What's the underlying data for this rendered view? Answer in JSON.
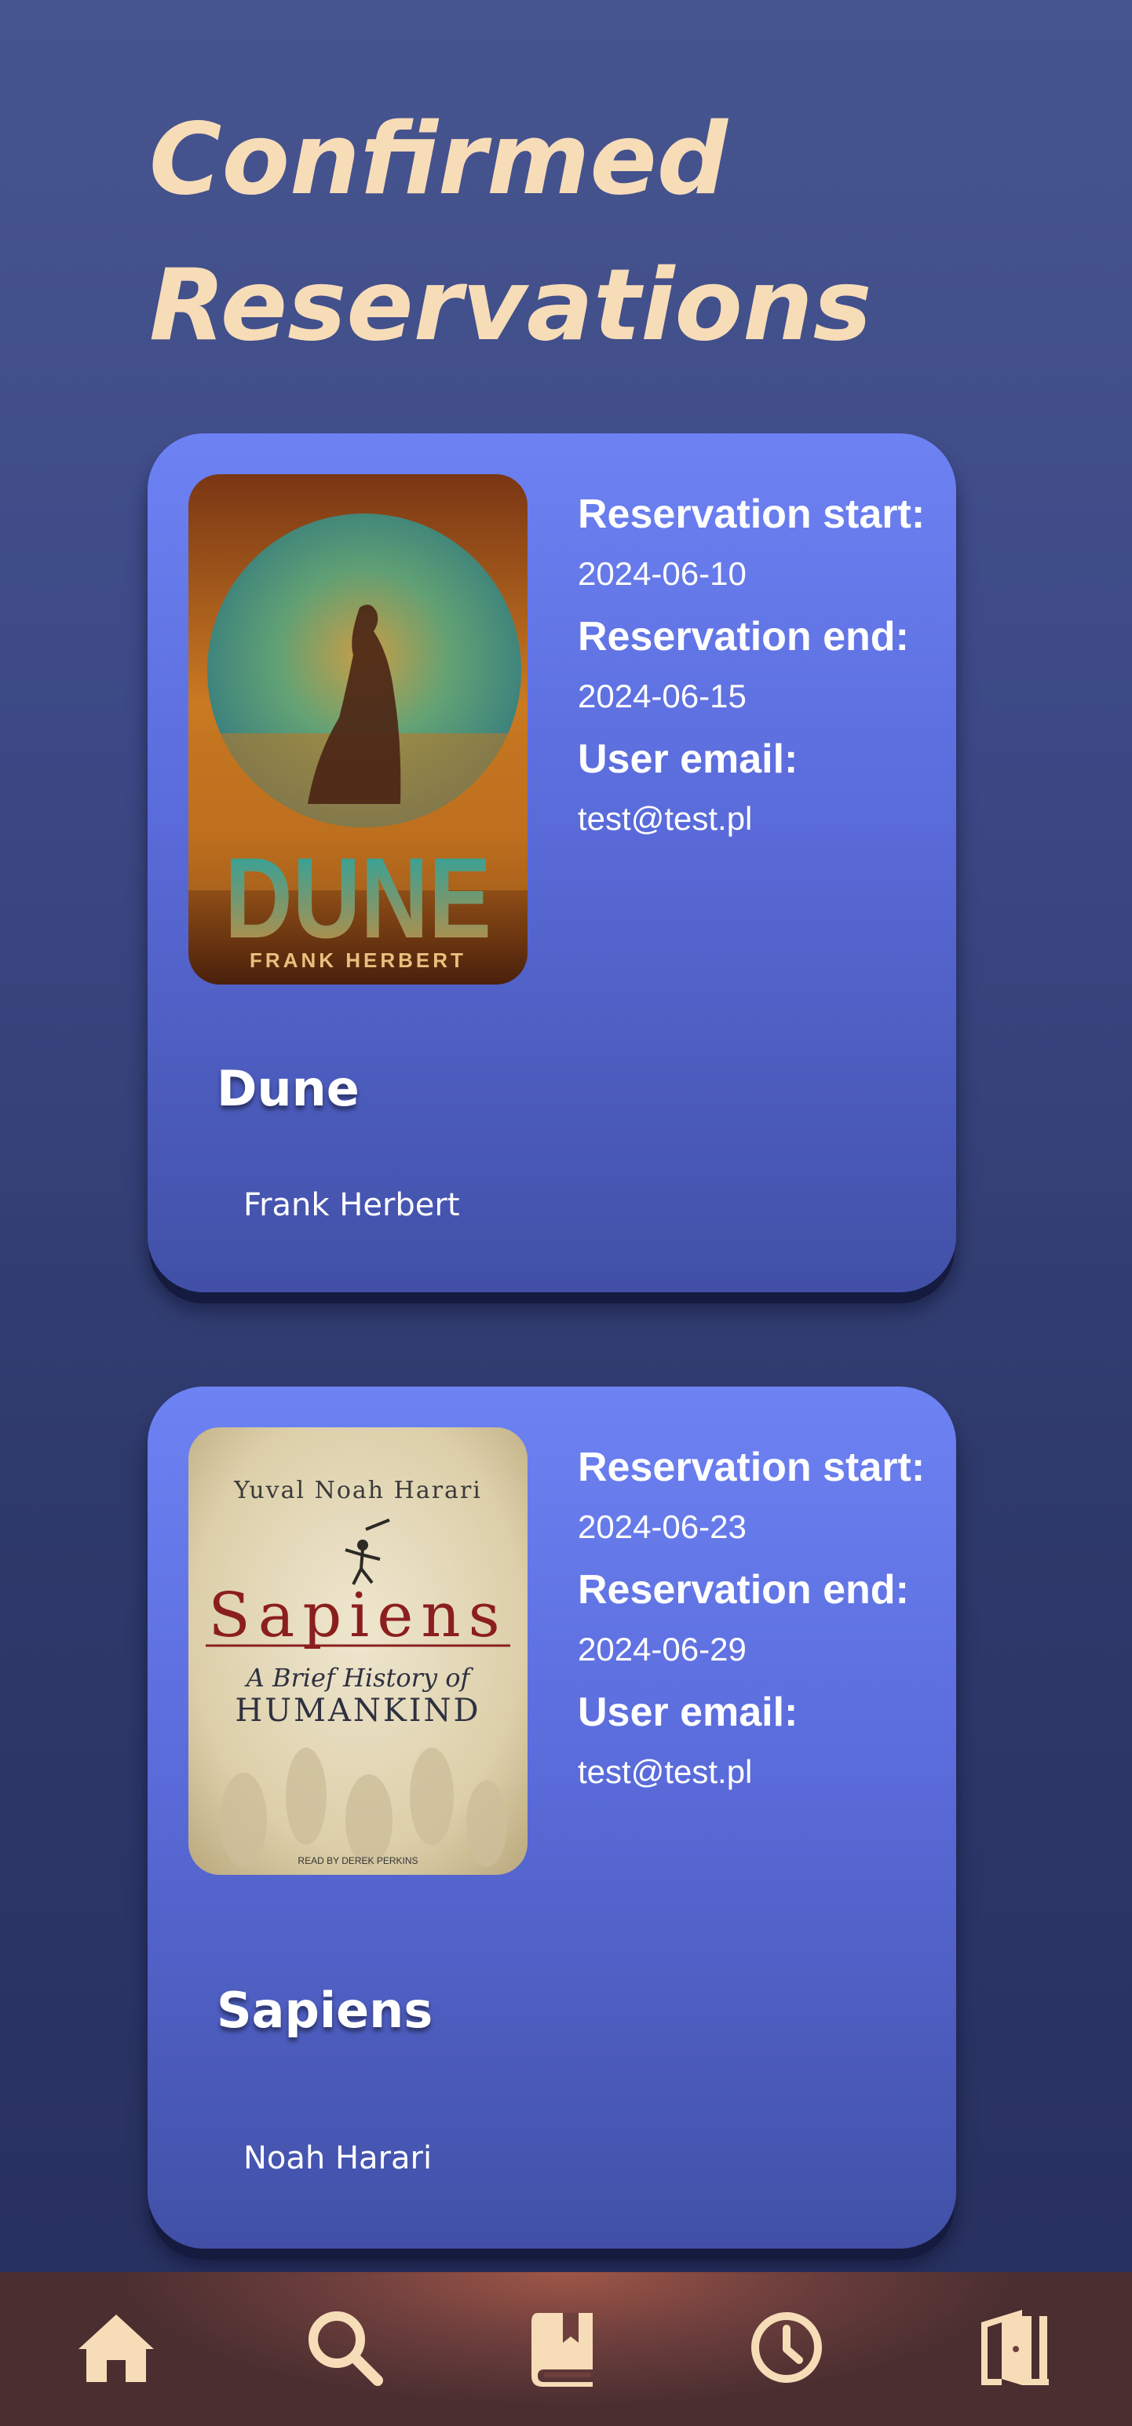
{
  "page": {
    "title_line1": "Confirmed",
    "title_line2": "Reservations"
  },
  "labels": {
    "start": "Reservation start:",
    "end": "Reservation end:",
    "email": "User email:"
  },
  "reservations": [
    {
      "title": "Dune",
      "author": "Frank Herbert",
      "start": "2024-06-10",
      "end": "2024-06-15",
      "email": "test@test.pl",
      "cover": {
        "title": "DUNE",
        "author": "FRANK HERBERT"
      }
    },
    {
      "title": "Sapiens",
      "author": "Noah Harari",
      "start": "2024-06-23",
      "end": "2024-06-29",
      "email": "test@test.pl",
      "cover": {
        "author": "Yuval Noah Harari",
        "title": "Sapiens",
        "subtitle_line1": "A Brief History of",
        "subtitle_line2": "HUMANKIND",
        "narrator": "READ BY DEREK PERKINS"
      }
    }
  ],
  "nav": {
    "items": [
      {
        "icon": "home-icon"
      },
      {
        "icon": "search-icon"
      },
      {
        "icon": "bookmark-book-icon"
      },
      {
        "icon": "clock-icon"
      },
      {
        "icon": "logout-door-icon"
      }
    ]
  },
  "colors": {
    "title": "#f7dcb8",
    "card_top": "#6d82f3",
    "card_bottom": "#4150a6",
    "nav_icon": "#f7dcb8"
  }
}
